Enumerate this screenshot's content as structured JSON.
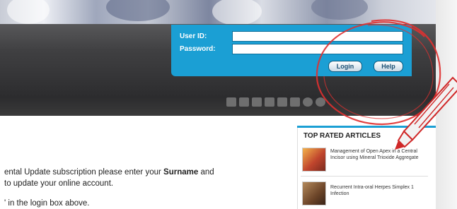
{
  "login": {
    "userid_label": "User ID:",
    "password_label": "Password:",
    "login_button": "Login",
    "help_button": "Help"
  },
  "content": {
    "line1_pre": "ental Update subscription please enter your ",
    "line1_bold": "Surname",
    "line1_post": " and",
    "line2": " to update your online account.",
    "line3": "' in the login box above."
  },
  "sidebar": {
    "title": "TOP RATED ARTICLES",
    "articles": [
      {
        "title": "Management of Open Apex in a Central Incisor using Mineral Trioxide Aggregate"
      },
      {
        "title": "Recurrent Intra-oral Herpes Simplex 1 Infection"
      }
    ]
  },
  "toolbar": {
    "icons": [
      "print-icon",
      "document-icon",
      "document-icon",
      "bookmark-icon",
      "text-size-icon",
      "share-icon",
      "refresh-icon",
      "help-icon"
    ]
  }
}
